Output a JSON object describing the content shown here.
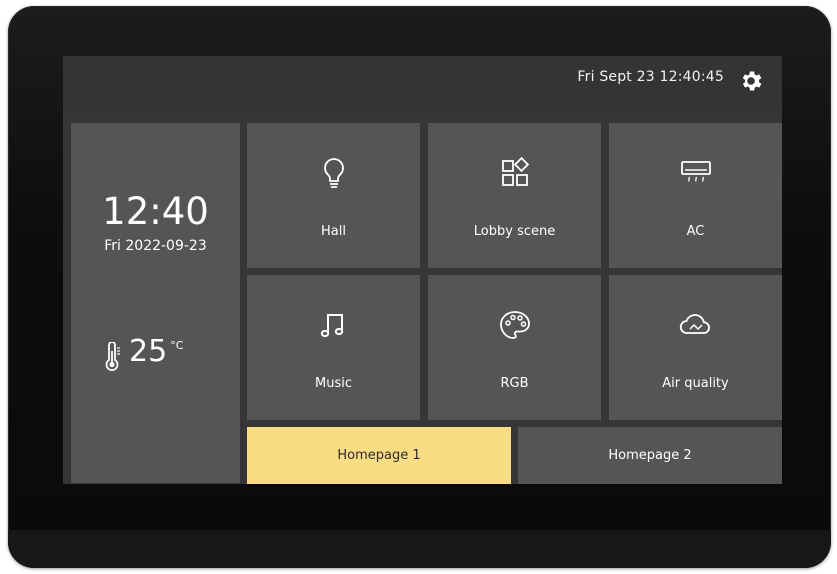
{
  "header": {
    "datetime": "Fri Sept 23  12:40:45"
  },
  "clock": {
    "time": "12:40",
    "date": "Fri 2022-09-23"
  },
  "temperature": {
    "value": "25",
    "unit": "°C"
  },
  "tiles": [
    {
      "label": "Hall",
      "icon": "lightbulb-icon"
    },
    {
      "label": "Lobby scene",
      "icon": "scene-grid-icon"
    },
    {
      "label": "AC",
      "icon": "air-conditioner-icon"
    },
    {
      "label": "Music",
      "icon": "music-note-icon"
    },
    {
      "label": "RGB",
      "icon": "palette-icon"
    },
    {
      "label": "Air quality",
      "icon": "cloud-icon"
    }
  ],
  "tabs": [
    {
      "label": "Homepage 1",
      "active": true
    },
    {
      "label": "Homepage 2",
      "active": false
    }
  ],
  "colors": {
    "accent": "#f9dc84",
    "tile": "#555555",
    "background": "#363636"
  }
}
